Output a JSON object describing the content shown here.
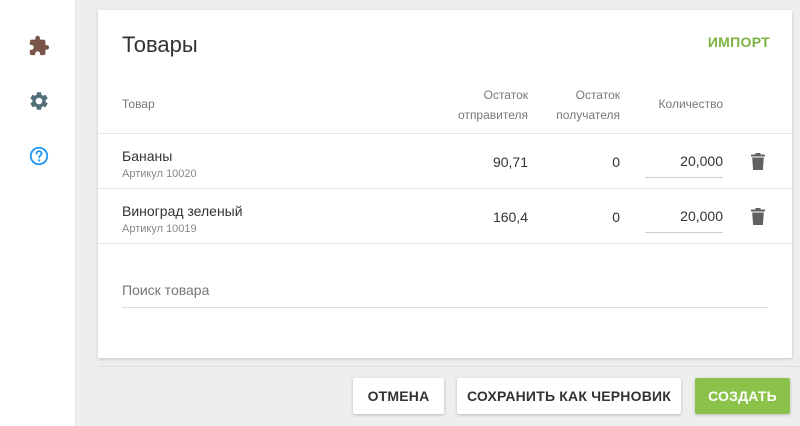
{
  "sidebar": {
    "icons": [
      {
        "name": "puzzle-icon",
        "color": "#795548"
      },
      {
        "name": "gear-icon",
        "color": "#546e7a"
      },
      {
        "name": "help-circle-icon",
        "color": "#2196f3"
      }
    ]
  },
  "card": {
    "title": "Товары",
    "import_label": "ИМПОРТ",
    "columns": {
      "product": "Товар",
      "sender_stock": "Остаток отправителя",
      "sender_stock_line1": "Остаток",
      "sender_stock_line2": "отправителя",
      "receiver_stock": "Остаток получателя",
      "receiver_stock_line1": "Остаток",
      "receiver_stock_line2": "получателя",
      "quantity": "Количество"
    },
    "rows": [
      {
        "name": "Бананы",
        "sku": "Артикул 10020",
        "sender_stock": "90,71",
        "receiver_stock": "0",
        "quantity": "20,000"
      },
      {
        "name": "Виноград зеленый",
        "sku": "Артикул 10019",
        "sender_stock": "160,4",
        "receiver_stock": "0",
        "quantity": "20,000"
      }
    ],
    "search_placeholder": "Поиск товара"
  },
  "footer": {
    "cancel_label": "ОТМЕНА",
    "draft_label": "СОХРАНИТЬ КАК ЧЕРНОВИК",
    "create_label": "СОЗДАТЬ"
  },
  "colors": {
    "accent": "#8bc34a",
    "import_link": "#7cb342"
  }
}
